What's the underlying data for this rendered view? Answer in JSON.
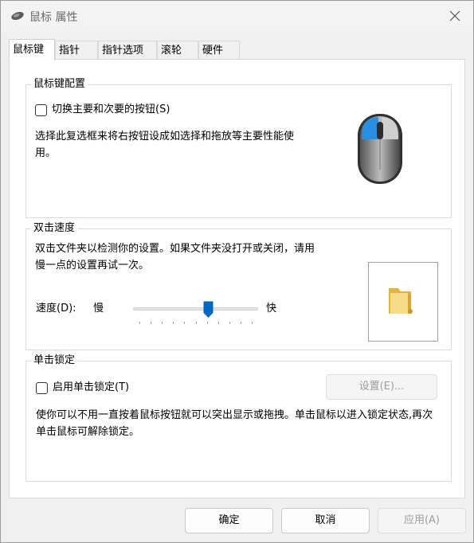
{
  "window": {
    "title": "鼠标 属性",
    "close_icon": "close-icon"
  },
  "tabs": [
    {
      "label": "鼠标键",
      "active": true
    },
    {
      "label": "指针",
      "active": false
    },
    {
      "label": "指针选项",
      "active": false
    },
    {
      "label": "滚轮",
      "active": false
    },
    {
      "label": "硬件",
      "active": false
    }
  ],
  "button_config": {
    "title": "鼠标键配置",
    "checkbox_label": "切换主要和次要的按钮(S)",
    "checked": false,
    "description": "选择此复选框来将右按钮设成如选择和拖放等主要性能使用。"
  },
  "double_click": {
    "title": "双击速度",
    "description": "双击文件夹以检测你的设置。如果文件夹没打开或关闭，请用慢一点的设置再试一次。",
    "speed_label": "速度(D):",
    "slow_label": "慢",
    "fast_label": "快",
    "speed_fraction": 0.6
  },
  "click_lock": {
    "title": "单击锁定",
    "checkbox_label": "启用单击锁定(T)",
    "checked": false,
    "settings_button": "设置(E)...",
    "description": "使你可以不用一直按着鼠标按钮就可以突出显示或拖拽。单击鼠标以进入锁定状态,再次单击鼠标可解除锁定。"
  },
  "footer": {
    "ok": "确定",
    "cancel": "取消",
    "apply": "应用(A)"
  },
  "colors": {
    "accent": "#0067c0",
    "mouse_button_highlight": "#2a8fe0"
  }
}
